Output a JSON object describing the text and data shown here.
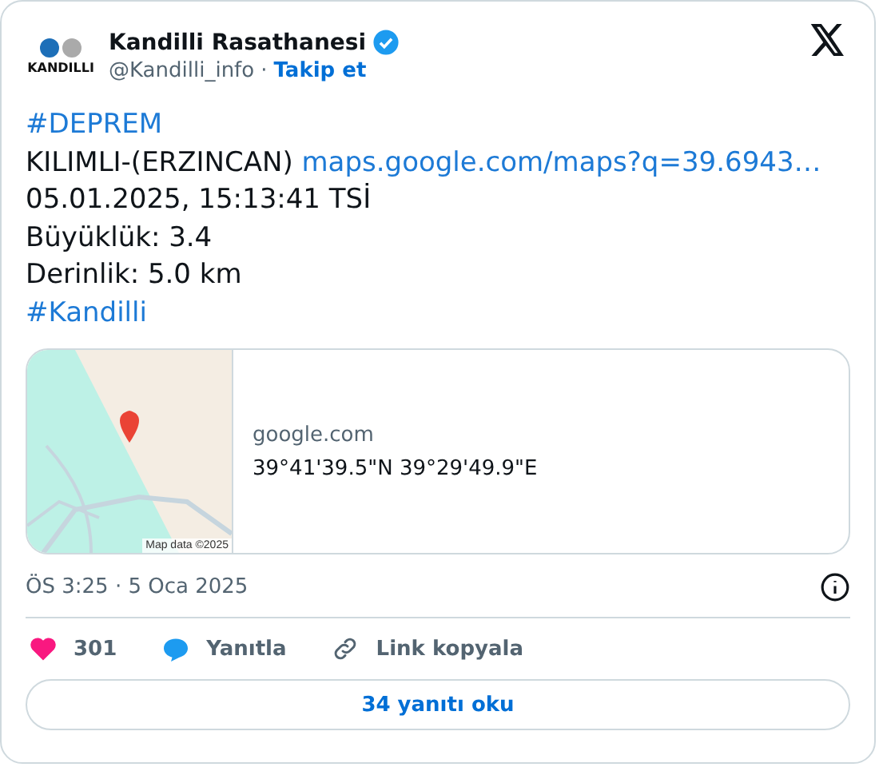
{
  "author": {
    "logo_text": "KANDILLI",
    "name": "Kandilli Rasathanesi",
    "verified": true,
    "handle": "@Kandilli_info",
    "separator": "·",
    "follow": "Takip et"
  },
  "body": [
    {
      "kind": "hashtag",
      "text": "#DEPREM"
    },
    {
      "kind": "mixed",
      "text": "KILIMLI-(ERZINCAN) ",
      "link": "maps.google.com/maps?q=39.6943…"
    },
    {
      "kind": "plain",
      "text": "05.01.2025, 15:13:41 TSİ"
    },
    {
      "kind": "plain",
      "text": "Büyüklük: 3.4"
    },
    {
      "kind": "plain",
      "text": "Derinlik: 5.0 km"
    },
    {
      "kind": "hashtag",
      "text": "#Kandilli"
    }
  ],
  "link_card": {
    "map_credit": "Map data ©2025",
    "domain": "google.com",
    "title": "39°41'39.5\"N 39°29'49.9\"E"
  },
  "timestamp": "ÖS 3:25 · 5 Oca 2025",
  "actions": [
    {
      "kind": "like",
      "label": "301"
    },
    {
      "kind": "reply",
      "label": "Yanıtla"
    },
    {
      "kind": "copy",
      "label": "Link kopyala"
    }
  ],
  "read_replies": "34 yanıtı oku"
}
